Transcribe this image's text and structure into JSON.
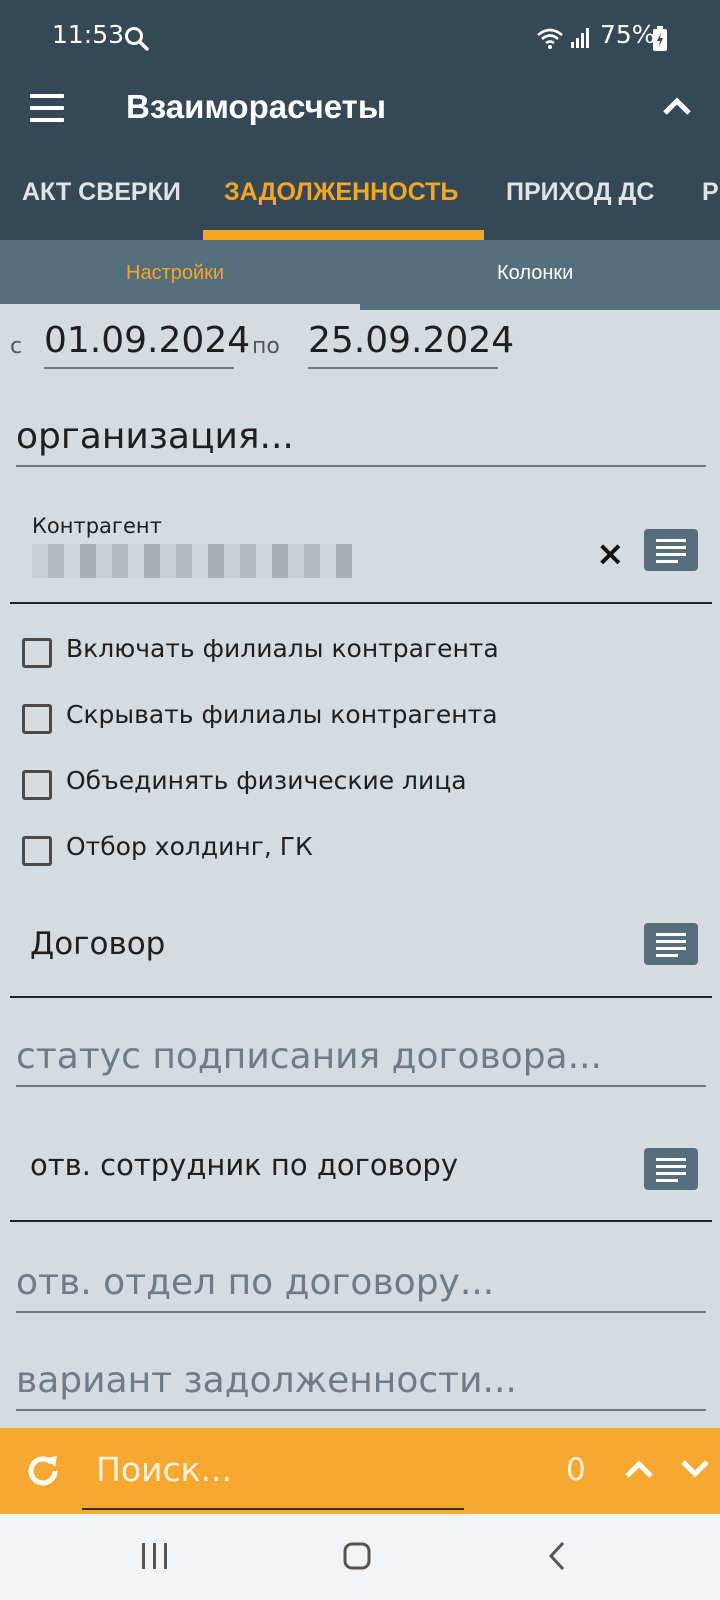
{
  "status_bar": {
    "time": "11:53",
    "battery": "75%"
  },
  "app_bar": {
    "title": "Взаиморасчеты"
  },
  "tabs": [
    {
      "label": "АКТ СВЕРКИ"
    },
    {
      "label": "ЗАДОЛЖЕННОСТЬ"
    },
    {
      "label": "ПРИХОД ДС"
    },
    {
      "label": "Р"
    }
  ],
  "subtabs": [
    {
      "label": "Настройки"
    },
    {
      "label": "Колонки"
    }
  ],
  "period": {
    "from_prefix": "с",
    "from": "01.09.2024",
    "to_prefix": "по",
    "to": "25.09.2024"
  },
  "organization": {
    "placeholder": "организация..."
  },
  "counterparty": {
    "label": "Контрагент"
  },
  "checkboxes": [
    {
      "label": "Включать филиалы контрагента",
      "checked": false
    },
    {
      "label": "Скрывать филиалы контрагента",
      "checked": false
    },
    {
      "label": "Объединять физические лица",
      "checked": false
    },
    {
      "label": "Отбор холдинг, ГК",
      "checked": false
    }
  ],
  "contract": {
    "label": "Договор"
  },
  "contract_status": {
    "placeholder": "статус подписания договора..."
  },
  "responsible_employee": {
    "label": "отв. сотрудник по договору"
  },
  "responsible_department": {
    "placeholder": "отв. отдел по договору..."
  },
  "debt_variant": {
    "placeholder": "вариант задолженности..."
  },
  "search": {
    "placeholder": "Поиск...",
    "count": "0"
  },
  "colors": {
    "header": "#344856",
    "subtabs": "#566e7c",
    "accent": "#f5a623",
    "background": "#d4dbe1",
    "searchbar": "#f7a82f"
  }
}
